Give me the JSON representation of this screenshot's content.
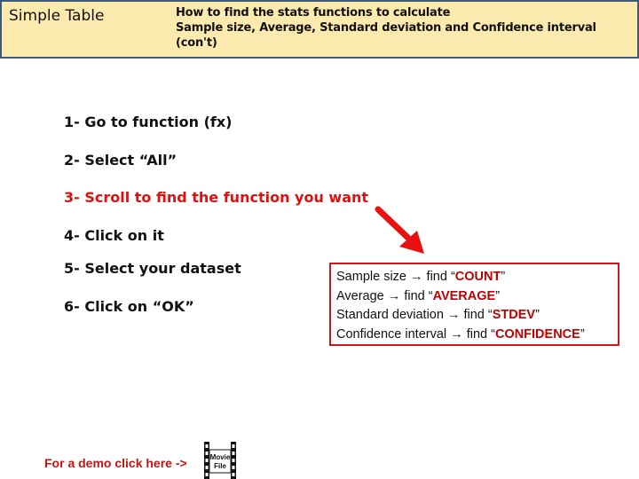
{
  "header": {
    "title": "Simple Table",
    "subtitle_lines": [
      "How to find the stats functions to calculate",
      "Sample size, Average, Standard deviation and Confidence interval",
      "(con't)"
    ]
  },
  "steps": [
    {
      "label": "1- Go to function (fx)",
      "highlight": false
    },
    {
      "label": "2- Select “All”",
      "highlight": false
    },
    {
      "label": "3- Scroll to find the function you want",
      "highlight": true
    },
    {
      "label": "4- Click on it",
      "highlight": false
    },
    {
      "label": "5- Select your dataset",
      "highlight": false
    },
    {
      "label": "6- Click on “OK”",
      "highlight": false
    }
  ],
  "info_box": {
    "rows": [
      {
        "label": "Sample size",
        "arrow": "→",
        "find": "find",
        "function": "COUNT"
      },
      {
        "label": "Average",
        "arrow": "→",
        "find": "find",
        "function": "AVERAGE"
      },
      {
        "label": "Standard deviation",
        "arrow": "→",
        "find": "find",
        "function": "STDEV"
      },
      {
        "label": "Confidence interval",
        "arrow": "→",
        "find": "find",
        "function": "CONFIDENCE"
      }
    ]
  },
  "demo": {
    "label": "For a demo click here ->",
    "movie_icon_line1": "Movie",
    "movie_icon_line2": "File"
  },
  "colors": {
    "header_bg": "#fdeaae",
    "header_border": "#3d5a74",
    "accent_red": "#e01010"
  }
}
